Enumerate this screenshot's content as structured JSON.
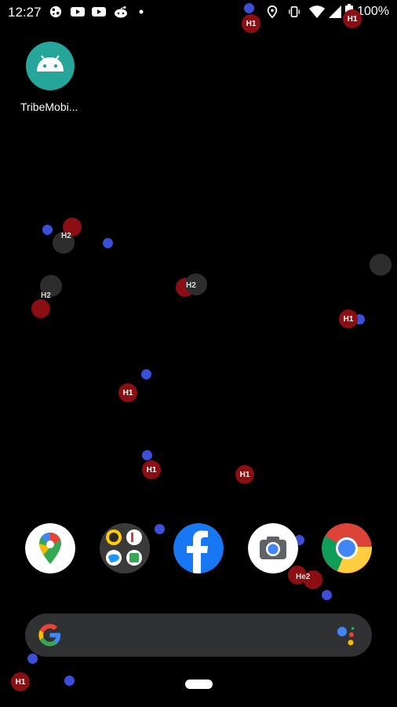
{
  "status_bar": {
    "time": "12:27",
    "battery": "100%",
    "icons": [
      "globe-icon",
      "youtube-icon",
      "youtube-icon",
      "reddit-icon",
      "dot-icon",
      "location-icon",
      "vibrate-icon",
      "wifi-icon",
      "signal-icon",
      "battery-icon"
    ]
  },
  "home": {
    "app_label": "TribeMobi...",
    "app_icon": "android-icon"
  },
  "particles": {
    "h1": "H1",
    "h2": "H2",
    "he2": "He2"
  },
  "dock": {
    "apps": [
      "maps-icon",
      "folder-icon",
      "facebook-icon",
      "camera-icon",
      "chrome-icon"
    ]
  },
  "search": {
    "logo": "google-g-icon",
    "assistant": "assistant-icon"
  },
  "colors": {
    "background": "#000000",
    "hydrogen": "#8b0f12",
    "electron": "#3b4fd8",
    "molecule": "#2d2d2d",
    "search_bar": "#303133"
  }
}
